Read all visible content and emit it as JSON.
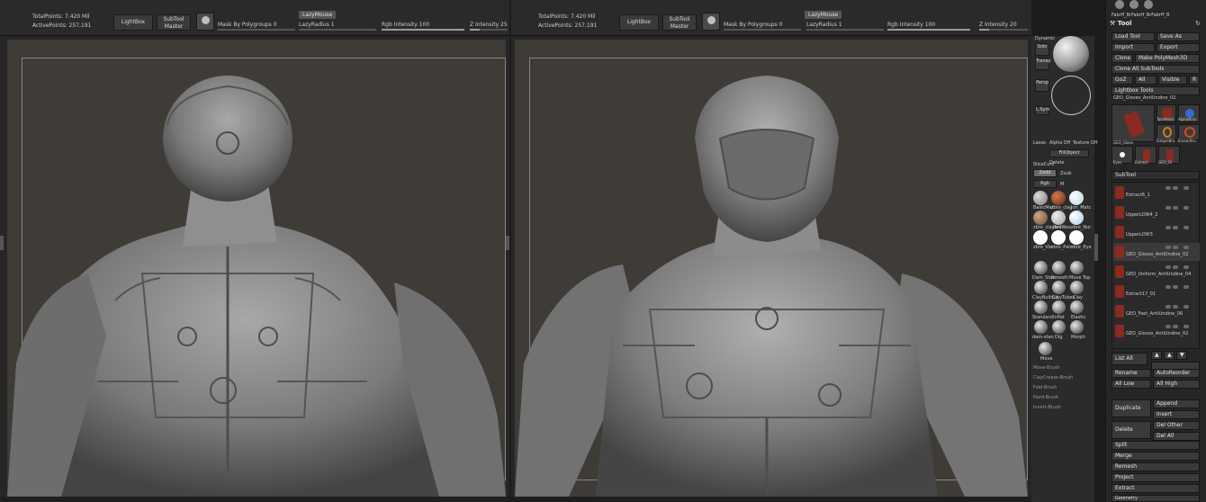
{
  "left_view": {
    "total_points": "TotalPoints: 7.420 Mil",
    "active_points": "ActivePoints: 257,191",
    "lightbox": "LightBox",
    "subtool_master": "SubTool Master",
    "mask_by_polygroups": "Mask By Polygroups 0",
    "lazymouse": "LazyMouse",
    "lazyradius": "LazyRadius 1",
    "rgb_intensity": "Rgb Intensity 100",
    "z_intensity": "Z Intensity 25"
  },
  "right_view": {
    "total_points": "TotalPoints: 7.420 Mil",
    "active_points": "ActivePoints: 257,191",
    "lightbox": "LightBox",
    "subtool_master": "SubTool Master",
    "mask_by_polygroups": "Mask By Polygroups 0",
    "lazymouse": "LazyMouse",
    "lazyradius": "LazyRadius 1",
    "rgb_intensity": "Rgb Intensity 100",
    "z_intensity": "Z Intensity 20"
  },
  "shelf": {
    "dynamic": "Dynamic",
    "solo": "Solo",
    "transp": "Transp",
    "persp": "Persp",
    "lsym": "L.Sym",
    "lasso": "Lasso",
    "alpha_off": "Alpha Off",
    "texture_off": "Texture Off",
    "fillobject": "FillObject",
    "delete": "Delete",
    "slicecurv": "SliceCurv",
    "zadd": "Zadd",
    "zsub": "Zsub",
    "rgb": "Rgb",
    "m": "M",
    "materials": [
      "BasicMat",
      "zbro_clay",
      "Jon_Matc",
      "zbre_claybrs",
      "RedWax",
      "zbre_Nur",
      "zbre_Vie",
      "zbro_Pain",
      "zbre_Eye"
    ],
    "brushes": [
      "Dam_Stan",
      "Smooth",
      "Move Top",
      "ClayBuildup",
      "ClayTubes",
      "Clay",
      "Standard",
      "Inflat",
      "Elastic",
      "dam-stan",
      "Dig",
      "Morph",
      "Move"
    ],
    "recent_brushes": [
      "Move-Brush",
      "ClayCrease-Brush",
      "Fold-Brush",
      "Hard-Brush",
      "Invert-Brush"
    ]
  },
  "tool_panel": {
    "top_label": "Fabrff_BrFabrff_BrFabrff_B",
    "title": "Tool",
    "load_tool": "Load Tool",
    "save_as": "Save As",
    "import": "Import",
    "export": "Export",
    "clone": "Clone",
    "make_polymesh": "Make PolyMesh3D",
    "clone_all": "Clone All SubTools",
    "goz": "GoZ",
    "all": "All",
    "visible": "Visible",
    "r": "R",
    "lightbox_tools": "Lightbox Tools",
    "current_tool": "GEO_Gloves_AntiUndine_02",
    "thumb_labels": [
      "TurnHead",
      "AlphaBrus",
      "SimpleBru",
      "EraserBru",
      "GEO_Glove",
      "Eyes",
      "Extract",
      "GEO_Gl"
    ],
    "subtool_header": "SubTool",
    "subtools": [
      "Extract6_1",
      "UpperLOW4_2",
      "UpperLOW3",
      "GEO_Gloves_AntiUndine_02",
      "GEO_Uniform_AntiUndine_04",
      "Extract17_01",
      "GEO_Feet_AntiUndine_06",
      "GEO_Gloves_AntiUndine_02"
    ],
    "list_all": "List All",
    "rename": "Rename",
    "autoreorder": "AutoReorder",
    "all_low": "All Low",
    "all_high": "All High",
    "duplicate": "Duplicate",
    "append": "Append",
    "insert": "Insert",
    "delete": "Delete",
    "del_other": "Del Other",
    "del_all": "Del All",
    "split": "Split",
    "merge": "Merge",
    "remesh": "Remesh",
    "project": "Project",
    "extract": "Extract",
    "geometry": "Geometry"
  },
  "colors": {
    "viewport": "#3f3b37",
    "ui_dark": "#262626",
    "button": "#3a3a3a",
    "subtool_red": "#8a2a22"
  }
}
